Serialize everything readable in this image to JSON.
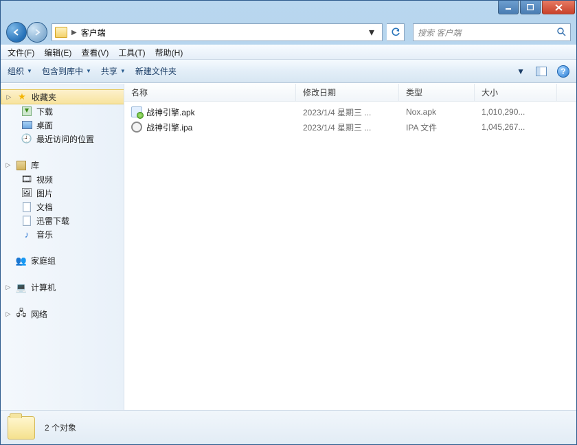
{
  "address": {
    "folder_name": "客户端"
  },
  "search": {
    "placeholder": "搜索 客户端"
  },
  "menubar": {
    "file": "文件(F)",
    "edit": "编辑(E)",
    "view": "查看(V)",
    "tools": "工具(T)",
    "help": "帮助(H)"
  },
  "toolbar": {
    "organize": "组织",
    "include": "包含到库中",
    "share": "共享",
    "newfolder": "新建文件夹"
  },
  "columns": {
    "name": "名称",
    "date": "修改日期",
    "type": "类型",
    "size": "大小"
  },
  "sidebar": {
    "favorites": "收藏夹",
    "downloads": "下载",
    "desktop": "桌面",
    "recent": "最近访问的位置",
    "libraries": "库",
    "videos": "视频",
    "pictures": "图片",
    "documents": "文档",
    "xunlei": "迅雷下载",
    "music": "音乐",
    "homegroup": "家庭组",
    "computer": "计算机",
    "network": "网络"
  },
  "files": [
    {
      "name": "战神引擎.apk",
      "date": "2023/1/4 星期三 ...",
      "type": "Nox.apk",
      "size": "1,010,290..."
    },
    {
      "name": "战神引擎.ipa",
      "date": "2023/1/4 星期三 ...",
      "type": "IPA 文件",
      "size": "1,045,267..."
    }
  ],
  "status": {
    "count": "2 个对象"
  }
}
